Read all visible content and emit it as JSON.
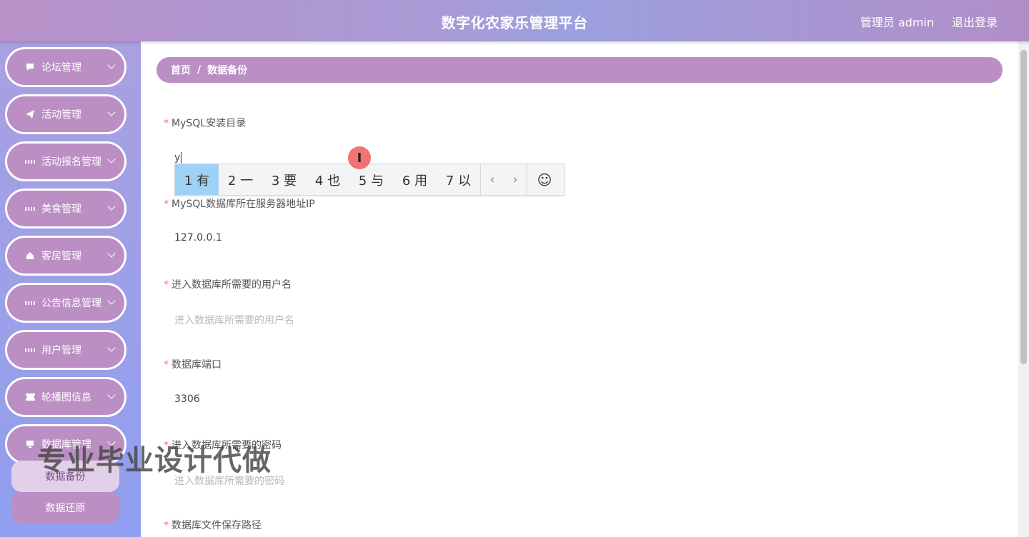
{
  "header": {
    "title": "数字化农家乐管理平台",
    "user_label": "管理员 admin",
    "logout": "退出登录"
  },
  "sidebar": {
    "items": [
      {
        "label": "论坛管理",
        "icon": "chat-icon"
      },
      {
        "label": "活动管理",
        "icon": "paper-plane-icon"
      },
      {
        "label": "活动报名管理",
        "icon": "grid-icon"
      },
      {
        "label": "美食管理",
        "icon": "grid-icon"
      },
      {
        "label": "客房管理",
        "icon": "house-icon"
      },
      {
        "label": "公告信息管理",
        "icon": "grid-icon"
      },
      {
        "label": "用户管理",
        "icon": "grid-icon"
      },
      {
        "label": "轮播图信息",
        "icon": "ticket-icon"
      },
      {
        "label": "数据库管理",
        "icon": "monitor-icon"
      }
    ],
    "submenu": [
      {
        "label": "数据备份",
        "active": true
      },
      {
        "label": "数据还原",
        "active": false
      }
    ]
  },
  "watermark": "专业毕业设计代做",
  "breadcrumb": {
    "home": "首页",
    "separator": "/",
    "current": "数据备份"
  },
  "form": {
    "fields": [
      {
        "label": "MySQL安装目录",
        "value": "y",
        "placeholder": ""
      },
      {
        "label": "MySQL数据库所在服务器地址IP",
        "value": "127.0.0.1",
        "placeholder": ""
      },
      {
        "label": "进入数据库所需要的用户名",
        "value": "",
        "placeholder": "进入数据库所需要的用户名"
      },
      {
        "label": "数据库端口",
        "value": "3306",
        "placeholder": ""
      },
      {
        "label": "进入数据库所需要的密码",
        "value": "",
        "placeholder": "进入数据库所需要的密码"
      },
      {
        "label": "数据库文件保存路径",
        "value": "",
        "placeholder": ""
      }
    ],
    "required_mark": "*"
  },
  "ime": {
    "candidates": [
      "1 有",
      "2 一",
      "3 要",
      "4 也",
      "5 与",
      "6 用",
      "7 以"
    ],
    "prev": "‹",
    "next": "›",
    "emoji": "☺"
  },
  "cursor_glyph": "I",
  "colors": {
    "accent": "#bb8fc4",
    "sidebar_bg": "#98a0e8",
    "required": "#f56c6c",
    "ime_selected": "#9fd0f6"
  }
}
